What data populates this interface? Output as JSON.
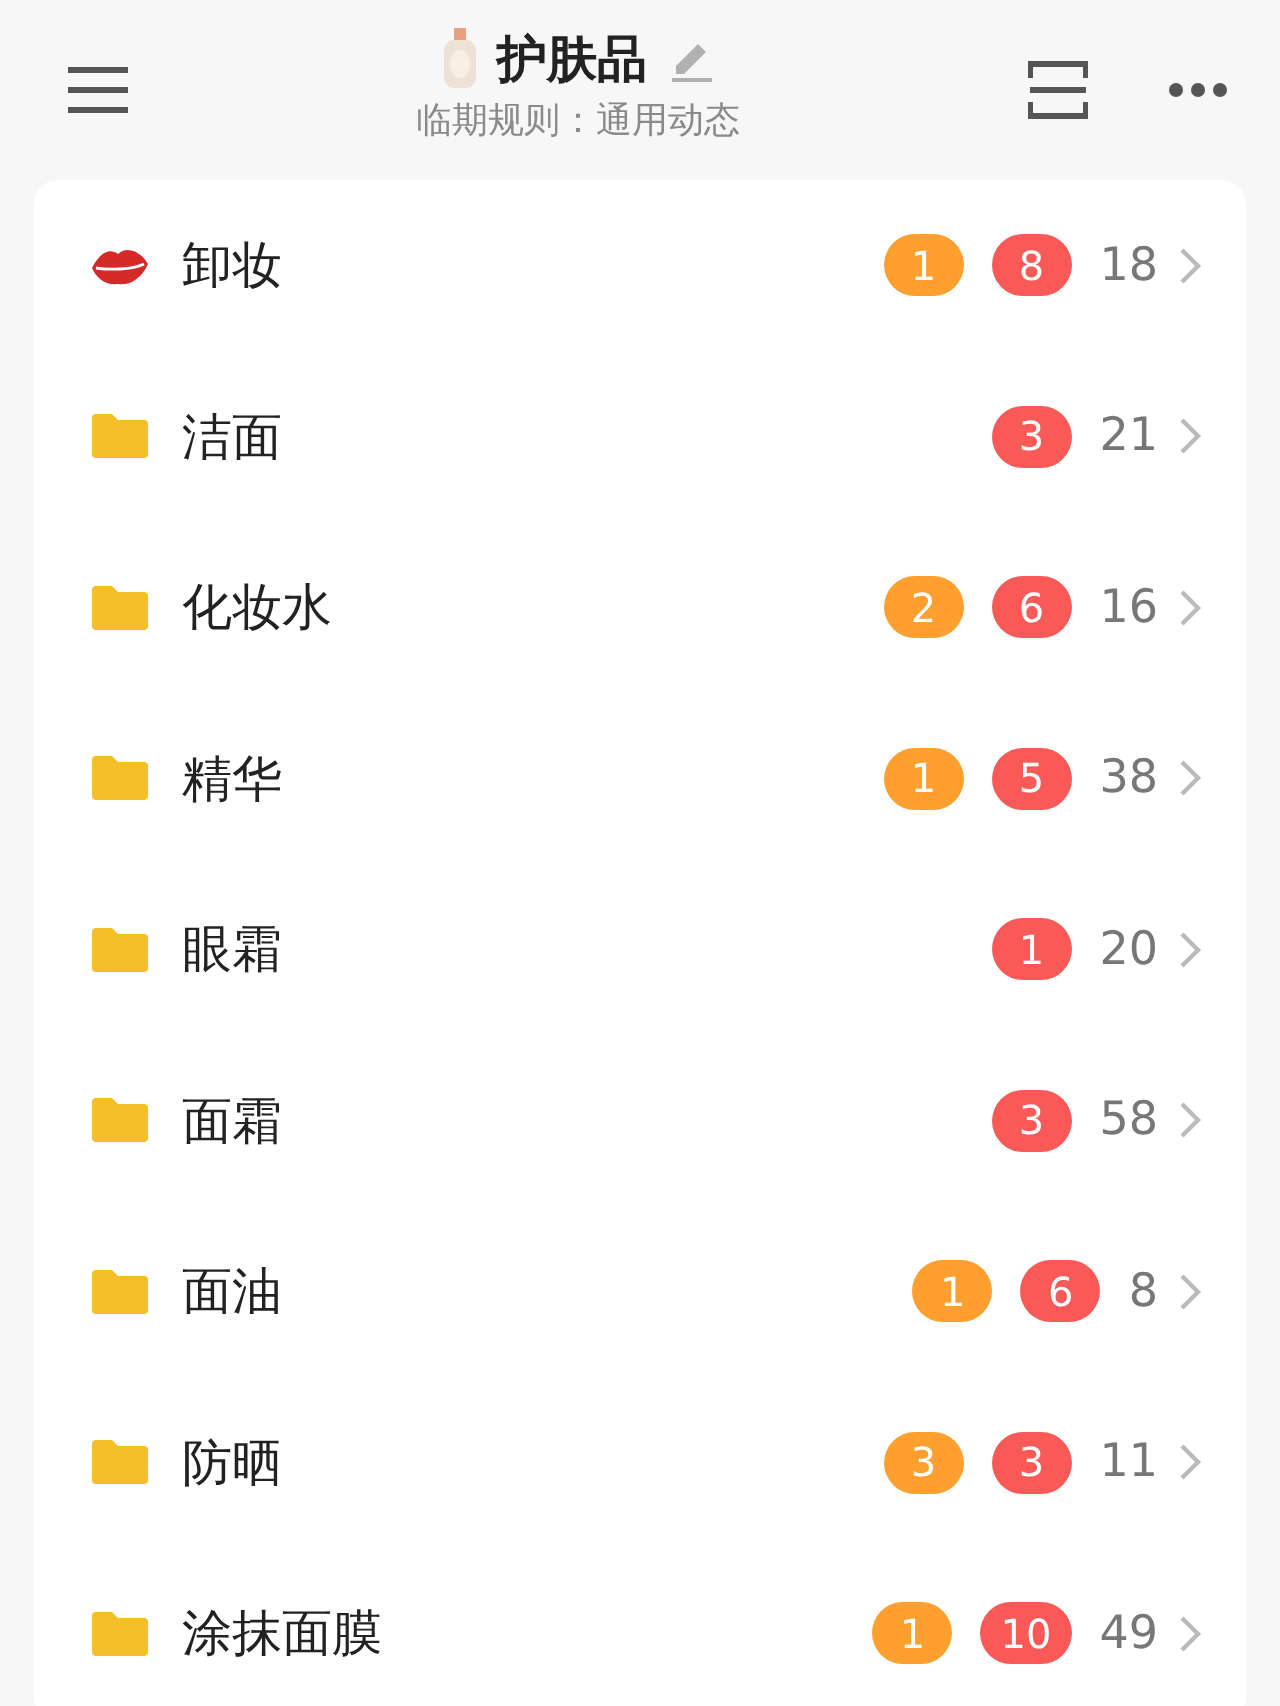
{
  "header": {
    "title": "护肤品",
    "subtitle": "临期规则：通用动态"
  },
  "categories": [
    {
      "kind": "lips",
      "name": "卸妆",
      "badges": [
        {
          "text": "1",
          "color": "#fe9f2f"
        },
        {
          "text": "8",
          "color": "#f95a57"
        }
      ],
      "count": "18"
    },
    {
      "kind": "folder",
      "name": "洁面",
      "badges": [
        {
          "text": "3",
          "color": "#f95a57"
        }
      ],
      "count": "21"
    },
    {
      "kind": "folder",
      "name": "化妆水",
      "badges": [
        {
          "text": "2",
          "color": "#fe9f2f"
        },
        {
          "text": "6",
          "color": "#f95a57"
        }
      ],
      "count": "16"
    },
    {
      "kind": "folder",
      "name": "精华",
      "badges": [
        {
          "text": "1",
          "color": "#fe9f2f"
        },
        {
          "text": "5",
          "color": "#f95a57"
        }
      ],
      "count": "38"
    },
    {
      "kind": "folder",
      "name": "眼霜",
      "badges": [
        {
          "text": "1",
          "color": "#f95a57"
        }
      ],
      "count": "20"
    },
    {
      "kind": "folder",
      "name": "面霜",
      "badges": [
        {
          "text": "3",
          "color": "#f95a57"
        }
      ],
      "count": "58"
    },
    {
      "kind": "folder",
      "name": "面油",
      "badges": [
        {
          "text": "1",
          "color": "#fe9f2f"
        },
        {
          "text": "6",
          "color": "#f95a57"
        }
      ],
      "count": "8"
    },
    {
      "kind": "folder",
      "name": "防晒",
      "badges": [
        {
          "text": "3",
          "color": "#fe9f2f"
        },
        {
          "text": "3",
          "color": "#f95a57"
        }
      ],
      "count": "11"
    },
    {
      "kind": "folder",
      "name": "涂抹面膜",
      "badges": [
        {
          "text": "1",
          "color": "#fe9f2f"
        },
        {
          "text": "10",
          "color": "#f95a57"
        }
      ],
      "count": "49"
    }
  ]
}
